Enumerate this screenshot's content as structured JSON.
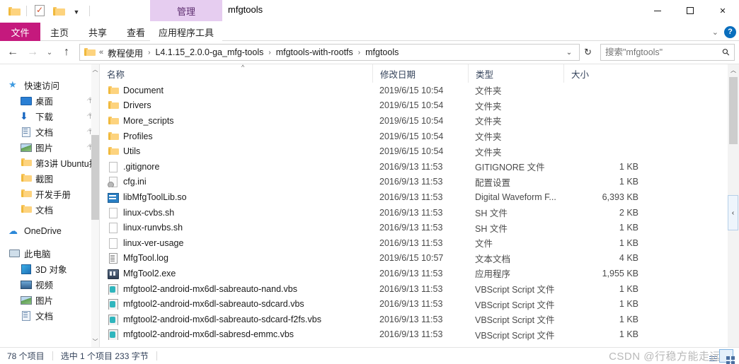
{
  "window": {
    "title": "mfgtools",
    "contextual_tab": "管理",
    "controls": {
      "minimize": "minimize-button",
      "maximize": "maximize-button",
      "close": "close-button"
    }
  },
  "quick_access_toolbar": {
    "items": [
      "folder-icon",
      "properties-icon",
      "new-folder-icon",
      "customize-dropdown"
    ]
  },
  "ribbon": {
    "tabs": [
      {
        "label": "文件",
        "active": false,
        "kind": "file"
      },
      {
        "label": "主页",
        "active": false,
        "kind": "normal"
      },
      {
        "label": "共享",
        "active": false,
        "kind": "normal"
      },
      {
        "label": "查看",
        "active": false,
        "kind": "normal"
      },
      {
        "label": "应用程序工具",
        "active": true,
        "kind": "contextual"
      }
    ],
    "expand_icon": "chevron-down-icon",
    "help_icon": "?"
  },
  "address_bar": {
    "back": "←",
    "forward": "→",
    "recent": "⌄",
    "up": "↑",
    "crumb_root": "«",
    "crumbs": [
      "教程使用",
      "L4.1.15_2.0.0-ga_mfg-tools",
      "mfgtools-with-rootfs",
      "mfgtools"
    ],
    "separator": "›",
    "dropdown": "⌄",
    "refresh": "↻"
  },
  "search": {
    "placeholder": "搜索\"mfgtools\"",
    "value": "",
    "icon": "search-icon"
  },
  "sidebar": {
    "groups": [
      {
        "label": "快速访问",
        "icon": "star-icon",
        "items": [
          {
            "label": "桌面",
            "icon": "desktop-icon",
            "pinned": true
          },
          {
            "label": "下载",
            "icon": "download-icon",
            "pinned": true
          },
          {
            "label": "文档",
            "icon": "documents-icon",
            "pinned": true
          },
          {
            "label": "图片",
            "icon": "pictures-icon",
            "pinned": true
          },
          {
            "label": "第3讲 Ubuntu操",
            "icon": "folder-icon",
            "pinned": false
          },
          {
            "label": "截图",
            "icon": "folder-icon",
            "pinned": false
          },
          {
            "label": "开发手册",
            "icon": "folder-icon",
            "pinned": false
          },
          {
            "label": "文档",
            "icon": "folder-icon",
            "pinned": false
          }
        ]
      },
      {
        "label": "OneDrive",
        "icon": "cloud-icon",
        "items": []
      },
      {
        "label": "此电脑",
        "icon": "this-pc-icon",
        "items": [
          {
            "label": "3D 对象",
            "icon": "3d-objects-icon",
            "pinned": false
          },
          {
            "label": "视频",
            "icon": "videos-icon",
            "pinned": false
          },
          {
            "label": "图片",
            "icon": "pictures-icon",
            "pinned": false
          },
          {
            "label": "文档",
            "icon": "documents-icon",
            "pinned": false
          }
        ]
      }
    ]
  },
  "file_list": {
    "columns": [
      {
        "label": "名称",
        "key": "name"
      },
      {
        "label": "修改日期",
        "key": "date"
      },
      {
        "label": "类型",
        "key": "type"
      },
      {
        "label": "大小",
        "key": "size"
      }
    ],
    "sort_indicator": "^",
    "rows": [
      {
        "name": "Document",
        "date": "2019/6/15 10:54",
        "type": "文件夹",
        "size": "",
        "icon": "folder-icon"
      },
      {
        "name": "Drivers",
        "date": "2019/6/15 10:54",
        "type": "文件夹",
        "size": "",
        "icon": "folder-icon"
      },
      {
        "name": "More_scripts",
        "date": "2019/6/15 10:54",
        "type": "文件夹",
        "size": "",
        "icon": "folder-icon"
      },
      {
        "name": "Profiles",
        "date": "2019/6/15 10:54",
        "type": "文件夹",
        "size": "",
        "icon": "folder-icon"
      },
      {
        "name": "Utils",
        "date": "2019/6/15 10:54",
        "type": "文件夹",
        "size": "",
        "icon": "folder-icon"
      },
      {
        "name": ".gitignore",
        "date": "2016/9/13 11:53",
        "type": "GITIGNORE 文件",
        "size": "1 KB",
        "icon": "blank-file-icon"
      },
      {
        "name": "cfg.ini",
        "date": "2016/9/13 11:53",
        "type": "配置设置",
        "size": "1 KB",
        "icon": "ini-file-icon"
      },
      {
        "name": "libMfgToolLib.so",
        "date": "2016/9/13 11:53",
        "type": "Digital Waveform F...",
        "size": "6,393 KB",
        "icon": "so-file-icon"
      },
      {
        "name": "linux-cvbs.sh",
        "date": "2016/9/13 11:53",
        "type": "SH 文件",
        "size": "2 KB",
        "icon": "blank-file-icon"
      },
      {
        "name": "linux-runvbs.sh",
        "date": "2016/9/13 11:53",
        "type": "SH 文件",
        "size": "1 KB",
        "icon": "blank-file-icon"
      },
      {
        "name": "linux-ver-usage",
        "date": "2016/9/13 11:53",
        "type": "文件",
        "size": "1 KB",
        "icon": "blank-file-icon"
      },
      {
        "name": "MfgTool.log",
        "date": "2019/6/15 10:57",
        "type": "文本文档",
        "size": "4 KB",
        "icon": "log-file-icon"
      },
      {
        "name": "MfgTool2.exe",
        "date": "2016/9/13 11:53",
        "type": "应用程序",
        "size": "1,955 KB",
        "icon": "exe-file-icon"
      },
      {
        "name": "mfgtool2-android-mx6dl-sabreauto-nand.vbs",
        "date": "2016/9/13 11:53",
        "type": "VBScript Script 文件",
        "size": "1 KB",
        "icon": "vbs-file-icon"
      },
      {
        "name": "mfgtool2-android-mx6dl-sabreauto-sdcard.vbs",
        "date": "2016/9/13 11:53",
        "type": "VBScript Script 文件",
        "size": "1 KB",
        "icon": "vbs-file-icon"
      },
      {
        "name": "mfgtool2-android-mx6dl-sabreauto-sdcard-f2fs.vbs",
        "date": "2016/9/13 11:53",
        "type": "VBScript Script 文件",
        "size": "1 KB",
        "icon": "vbs-file-icon"
      },
      {
        "name": "mfgtool2-android-mx6dl-sabresd-emmc.vbs",
        "date": "2016/9/13 11:53",
        "type": "VBScript Script 文件",
        "size": "1 KB",
        "icon": "vbs-file-icon"
      }
    ]
  },
  "preview_tab": "‹",
  "status_bar": {
    "item_count": "78 个项目",
    "selection": "选中 1 个项目  233 字节",
    "view_details": "details-view-button",
    "view_icons": "icons-view-button"
  },
  "watermark": "CSDN @行稳方能走远"
}
